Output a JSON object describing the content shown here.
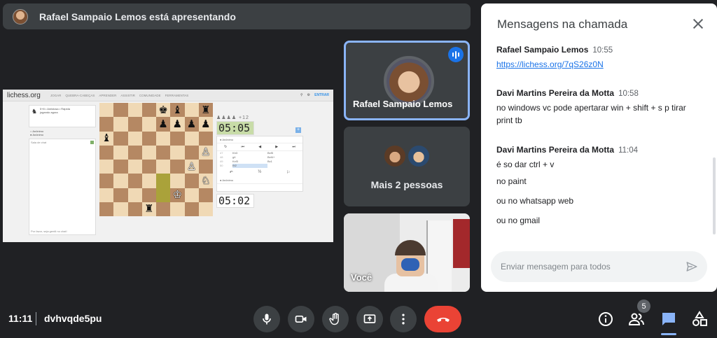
{
  "banner": {
    "presenter_text": "Rafael Sampaio Lemos está apresentando"
  },
  "screen": {
    "logo": "lichess.org",
    "nav": [
      "Jogar",
      "Quebra-cabeças",
      "Aprender",
      "Assistir",
      "Comunidade",
      "Ferramentas"
    ],
    "signin": "ENTRAR",
    "game_info": [
      "5+8 • Amistosa • Rápida",
      "jogando agora"
    ],
    "players": [
      "Anônimo",
      "Anônimo"
    ],
    "chat_title": "Sala de chat",
    "chat_footer": "Por favor, seja gentil no chat!",
    "captured": "♟♟♟♟ +12",
    "clock_top": "05:05",
    "clock_bottom": "05:02",
    "player_top": "Anônimo",
    "player_bottom": "Anônimo",
    "move_controls": [
      "↻",
      "⏮",
      "◀",
      "▶",
      "⏭"
    ],
    "moves": [
      {
        "n": "47",
        "w": "Kh3",
        "b": "Bxf5"
      },
      {
        "n": "48",
        "w": "g4",
        "b": "Bxf4+"
      },
      {
        "n": "49",
        "w": "Kxf3",
        "b": "Bc1"
      },
      {
        "n": "50",
        "w": "Bf2",
        "b": ""
      }
    ],
    "move_actions": [
      "↶",
      "½",
      "⚐"
    ]
  },
  "tiles": {
    "speaker_name": "Rafael Sampaio Lemos",
    "others_label": "Mais 2 pessoas",
    "self_name": "Você"
  },
  "chat": {
    "title": "Mensagens na chamada",
    "messages": [
      {
        "sender": "Rafael Sampaio Lemos",
        "time": "10:55",
        "text": "https://lichess.org/7qS26z0N"
      },
      {
        "sender": "Davi Martins Pereira da Motta",
        "time": "10:58",
        "text": "no windows vc pode apertarar win + shift + s p tirar print tb"
      },
      {
        "sender": "Davi Martins Pereira da Motta",
        "time": "11:04",
        "text": "é so dar ctrl + v"
      }
    ],
    "extra_lines": [
      "no paint",
      "ou no whatsapp web",
      "ou no gmail"
    ],
    "compose_placeholder": "Enviar mensagem para todos"
  },
  "bottom": {
    "time": "11:11",
    "meeting_code": "dvhvqde5pu",
    "participant_count": "5"
  },
  "icons": {
    "mic": "mic-icon",
    "camera": "camera-icon",
    "hand": "raise-hand-icon",
    "present": "present-screen-icon",
    "more": "more-options-icon",
    "hangup": "hang-up-icon",
    "info": "info-icon",
    "people": "people-icon",
    "chat": "chat-icon",
    "activities": "activities-icon"
  },
  "colors": {
    "accent": "#8ab4f8",
    "hangup": "#ea4335",
    "link": "#1a73e8",
    "background": "#202124"
  }
}
